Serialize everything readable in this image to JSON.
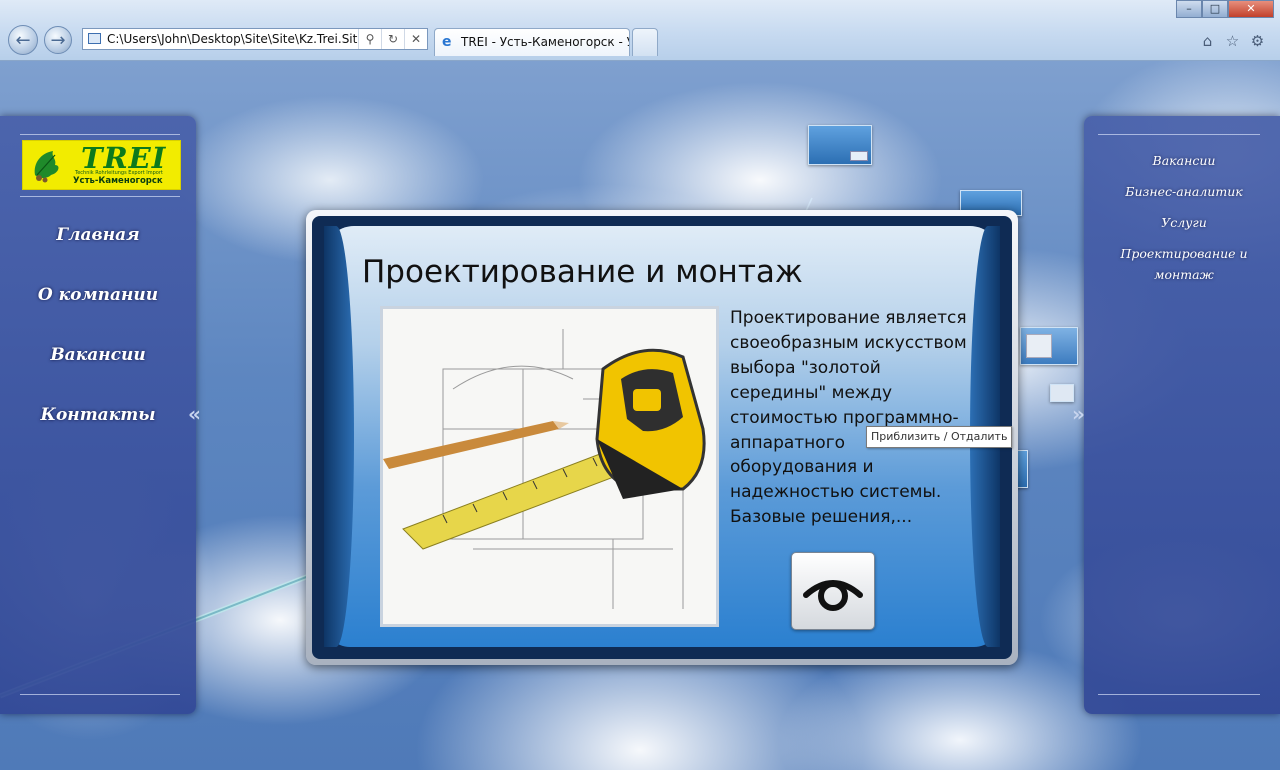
{
  "browser": {
    "address": "C:\\Users\\John\\Desktop\\Site\\Site\\Kz.Trei.Site",
    "tab_title": "TREI - Усть-Каменогорск - У..."
  },
  "logo": {
    "name": "TREI",
    "subtitle": "Technik Rohrleitungs Export Import",
    "city": "Усть-Каменогорск"
  },
  "left_menu": [
    "Главная",
    "О компании",
    "Вакансии",
    "Контакты"
  ],
  "right_menu": {
    "items": [
      "Вакансии",
      "Бизнес-аналитик",
      "Услуги"
    ],
    "last_line1": "Проектирование и",
    "last_line2": "монтаж"
  },
  "dialog": {
    "title": "Проектирование и монтаж",
    "text": "Проектирование является своеобразным искусством выбора \"золотой середины\" между стоимостью программно-аппаратного оборудования и надежностью системы. Базовые решения,...",
    "image": "tape-measure-on-blueprints"
  },
  "tooltip": "Приблизить / Отдалить",
  "icons": {
    "back": "back-arrow-icon",
    "forward": "forward-arrow-icon",
    "home": "home-icon",
    "favorites": "star-icon",
    "tools": "gear-icon",
    "view": "eye-icon"
  },
  "colors": {
    "panel": "#3f5aa8",
    "dialog_blue": "#2b80d0",
    "logo_bg": "#f2ec00",
    "logo_text": "#0c7a1c"
  }
}
